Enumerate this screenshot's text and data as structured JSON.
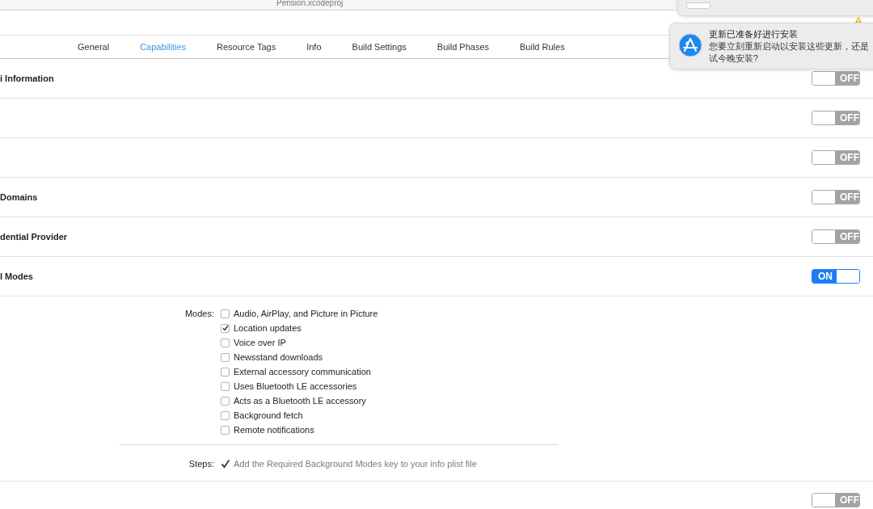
{
  "window": {
    "title": "Pension.xcodeproj"
  },
  "tabs": [
    {
      "label": "General",
      "selected": false
    },
    {
      "label": "Capabilities",
      "selected": true
    },
    {
      "label": "Resource Tags",
      "selected": false
    },
    {
      "label": "Info",
      "selected": false
    },
    {
      "label": "Build Settings",
      "selected": false
    },
    {
      "label": "Build Phases",
      "selected": false
    },
    {
      "label": "Build Rules",
      "selected": false
    }
  ],
  "capabilities": [
    {
      "name": "i Information",
      "on": false,
      "switch_label": "OFF"
    },
    {
      "on": false,
      "switch_label": "OFF"
    },
    {
      "on": false,
      "switch_label": "OFF"
    },
    {
      "name": "Domains",
      "on": false,
      "switch_label": "OFF"
    },
    {
      "name": "dential Provider",
      "on": false,
      "switch_label": "OFF"
    },
    {
      "name": "l Modes",
      "on": true,
      "switch_label": "ON",
      "expanded": true
    },
    {
      "on": false,
      "switch_label": "OFF"
    }
  ],
  "background_modes": {
    "label": "Modes:",
    "modes": [
      {
        "label": "Audio, AirPlay, and Picture in Picture",
        "checked": false
      },
      {
        "label": "Location updates",
        "checked": true
      },
      {
        "label": "Voice over IP",
        "checked": false
      },
      {
        "label": "Newsstand downloads",
        "checked": false
      },
      {
        "label": "External accessory communication",
        "checked": false
      },
      {
        "label": "Uses Bluetooth LE accessories",
        "checked": false
      },
      {
        "label": "Acts as a Bluetooth LE accessory",
        "checked": false
      },
      {
        "label": "Background fetch",
        "checked": false
      },
      {
        "label": "Remote notifications",
        "checked": false
      }
    ],
    "steps_label": "Steps:",
    "steps": [
      {
        "text": "Add the Required Background Modes key to your info plist file",
        "done": true
      }
    ]
  },
  "notifications": [
    {
      "kind": "collapsed"
    },
    {
      "kind": "alert",
      "title": "更新已准备好进行安装",
      "body_lines": [
        "您要立刻重新启动以安装这些更新，还是",
        "试今晚安装?"
      ]
    }
  ]
}
